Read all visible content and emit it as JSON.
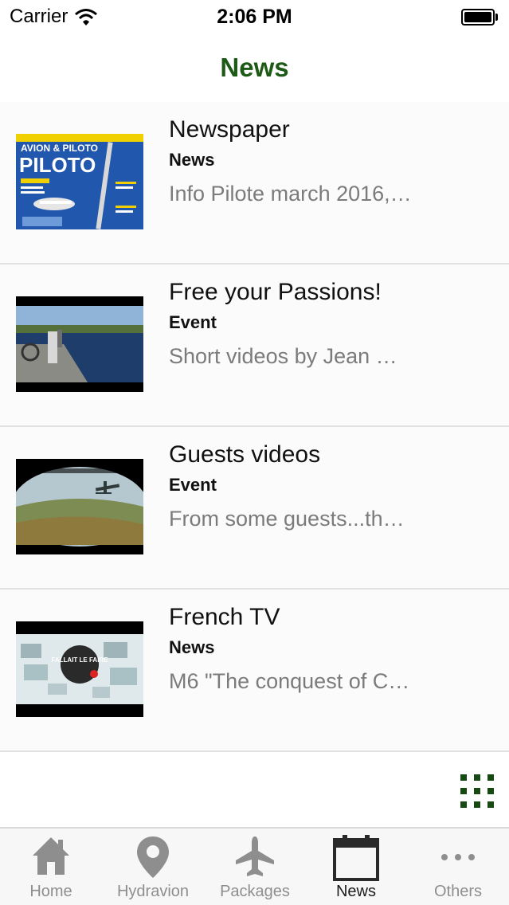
{
  "status_bar": {
    "carrier": "Carrier",
    "time": "2:06 PM"
  },
  "header": {
    "title": "News"
  },
  "items": [
    {
      "title": "Newspaper",
      "category": "News",
      "description": "Info Pilote march 2016,…",
      "thumbnail": "magazine-cover",
      "magazine_title": "AVION & PILOTO"
    },
    {
      "title": "Free your Passions!",
      "category": "Event",
      "description": "Short videos by Jean …",
      "thumbnail": "lake-dock-video"
    },
    {
      "title": "Guests videos",
      "category": "Event",
      "description": "From some guests...th…",
      "thumbnail": "seaplane-video"
    },
    {
      "title": "French TV",
      "category": "News",
      "description": "M6 \"The conquest of C…",
      "thumbnail": "tv-show-video",
      "logo_text": "FALLAIT LE FAIRE"
    }
  ],
  "tabs": [
    {
      "label": "Home",
      "icon": "house-icon",
      "active": false
    },
    {
      "label": "Hydravion",
      "icon": "map-pin-icon",
      "active": false
    },
    {
      "label": "Packages",
      "icon": "airplane-icon",
      "active": false
    },
    {
      "label": "News",
      "icon": "calendar-icon",
      "active": true
    },
    {
      "label": "Others",
      "icon": "more-dots-icon",
      "active": false
    }
  ],
  "colors": {
    "accent": "#1d5a16",
    "tab_inactive": "#8e8e8e",
    "tab_active": "#1c1c1c"
  }
}
